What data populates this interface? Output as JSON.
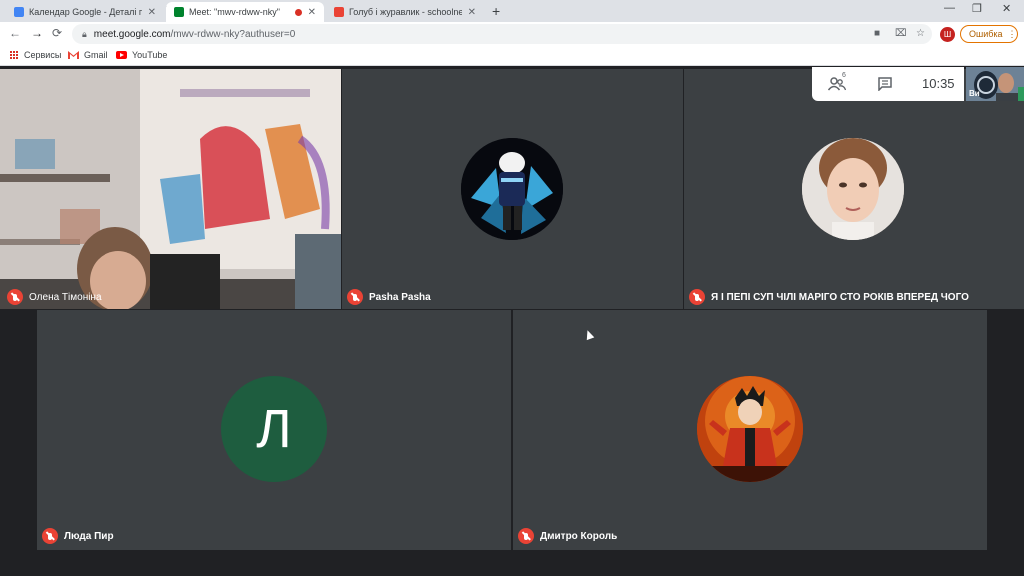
{
  "tabs": [
    {
      "title": "Календар Google - Деталі події",
      "favicon_color": "#4285f4"
    },
    {
      "title": "Meet: \"mwv-rdww-nky\"",
      "favicon_color": "#00832d"
    },
    {
      "title": "Голуб і журавлик - schoolnextw...",
      "favicon_color": "#ea4335"
    }
  ],
  "window_controls": {
    "minimize": "—",
    "maximize": "❐",
    "close": "✕"
  },
  "address": {
    "host": "meet.google.com",
    "path": "/mwv-rdww-nky?authuser=0"
  },
  "profile_letter": "Ш",
  "error_label": "Ошибка",
  "bookmarks": [
    {
      "label": "Сервисы",
      "icon": "apps-grid-icon"
    },
    {
      "label": "Gmail",
      "icon": "gmail-icon"
    },
    {
      "label": "YouTube",
      "icon": "youtube-icon"
    }
  ],
  "meet": {
    "people_count": "6",
    "clock": "10:35",
    "self_view_label": "Ви",
    "participants": [
      {
        "name": "Олена Тімоніна",
        "muted": true,
        "kind": "video"
      },
      {
        "name": "Pasha Pasha",
        "muted": true,
        "kind": "avatar"
      },
      {
        "name": "Я І ПЕПІ СУП ЧІЛІ МАРІГО СТО РОКІВ ВПЕРЕД ЧОГО",
        "muted": true,
        "kind": "avatar"
      },
      {
        "name": "Люда Пир",
        "muted": true,
        "kind": "letter",
        "letter": "Л"
      },
      {
        "name": "Дмитро Король",
        "muted": true,
        "kind": "avatar"
      }
    ]
  },
  "colors": {
    "meet_bg": "#202124",
    "tile_bg": "#3c4043",
    "muted_red": "#ea4335",
    "letter_avatar_green": "#1e5d3f"
  }
}
